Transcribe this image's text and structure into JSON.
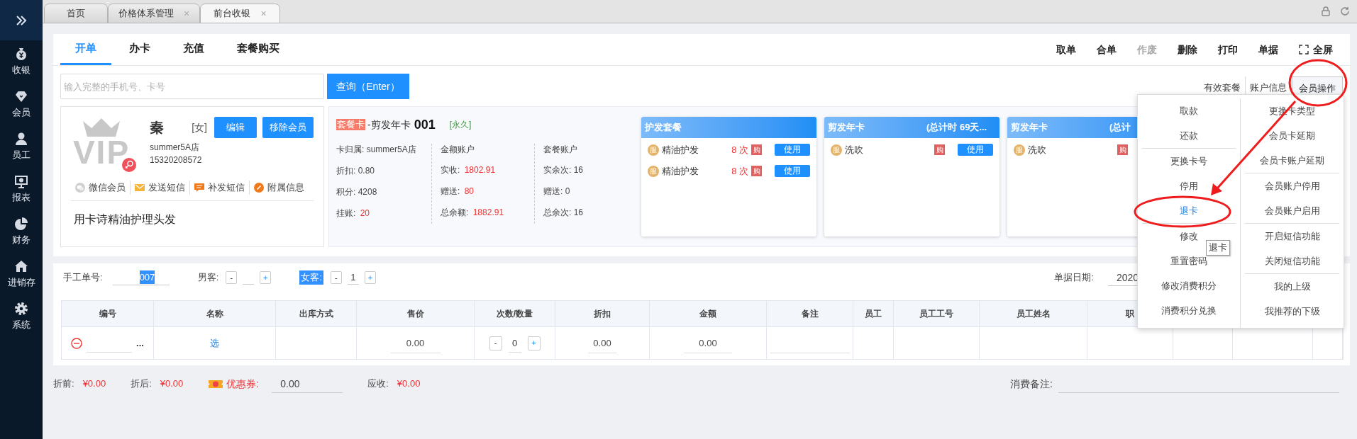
{
  "top_tabs": [
    {
      "label": "首页",
      "selected": false
    },
    {
      "label": "价格体系管理",
      "close": "×",
      "selected": false
    },
    {
      "label": "前台收银",
      "close": "×",
      "selected": true
    }
  ],
  "sidebar": {
    "items": [
      {
        "label": "收银",
        "kind": "cashier"
      },
      {
        "label": "会员",
        "kind": "member"
      },
      {
        "label": "员工",
        "kind": "staff"
      },
      {
        "label": "报表",
        "kind": "report"
      },
      {
        "label": "财务",
        "kind": "finance"
      },
      {
        "label": "进销存",
        "kind": "inventory"
      },
      {
        "label": "系统",
        "kind": "system"
      }
    ]
  },
  "order_tabs": [
    {
      "label": "开单",
      "selected": true
    },
    {
      "label": "办卡",
      "selected": false
    },
    {
      "label": "充值",
      "selected": false
    },
    {
      "label": "套餐购买",
      "selected": false
    }
  ],
  "toolbar": [
    {
      "label": "取单",
      "kind": "plain",
      "disabled": false
    },
    {
      "label": "合单",
      "kind": "plain",
      "disabled": false
    },
    {
      "label": "作废",
      "kind": "plain",
      "disabled": true
    },
    {
      "label": "删除",
      "kind": "plain",
      "disabled": false
    },
    {
      "label": "打印",
      "kind": "plain",
      "disabled": false
    },
    {
      "label": "单据",
      "kind": "plain",
      "disabled": false
    },
    {
      "label": "全屏",
      "kind": "fullscreen",
      "disabled": false
    }
  ],
  "search": {
    "placeholder": "输入完整的手机号、卡号",
    "button": "查询（Enter）"
  },
  "member_tabs": [
    {
      "label": "有效套餐",
      "selected": false
    },
    {
      "label": "账户信息",
      "selected": false
    },
    {
      "label": "会员操作",
      "selected": true
    }
  ],
  "member": {
    "avatar_text": "VIP",
    "name": "秦",
    "gender": "[女]",
    "buttons": [
      "编辑",
      "移除会员"
    ],
    "store": "summer5A店",
    "phone": "15320208572",
    "actions": [
      {
        "label": "微信会员",
        "kind": "wechat"
      },
      {
        "label": "发送短信",
        "kind": "mail"
      },
      {
        "label": "补发短信",
        "kind": "message"
      },
      {
        "label": "附属信息",
        "kind": "link"
      }
    ],
    "note": "用卡诗精油护理头发"
  },
  "card": {
    "type_tag": "套餐卡",
    "name": "-剪发年卡",
    "number": "001",
    "validity": "[永久]",
    "columns": [
      {
        "rows": [
          {
            "label": "卡归属:",
            "value": "summer5A店",
            "highlight": false
          },
          {
            "label": "折扣:",
            "value": "0.80",
            "highlight": false
          },
          {
            "label": "积分:",
            "value": "4208",
            "highlight": false
          },
          {
            "label": "挂账:",
            "value": "20",
            "highlight": true
          }
        ]
      },
      {
        "heading": "金额账户",
        "rows": [
          {
            "label": "实收:",
            "value": "1802.91",
            "highlight": true
          },
          {
            "label": "赠送:",
            "value": "80",
            "highlight": true
          },
          {
            "label": "总余额:",
            "value": "1882.91",
            "highlight": true
          }
        ]
      },
      {
        "heading": "套餐账户",
        "rows": [
          {
            "label": "实余次:",
            "value": "16",
            "highlight": false
          },
          {
            "label": "赠送:",
            "value": "0",
            "highlight": false
          },
          {
            "label": "总余次:",
            "value": "16",
            "highlight": false
          }
        ]
      }
    ]
  },
  "packages": [
    {
      "title": "护发套餐",
      "items": [
        {
          "badge": "服",
          "name": "精油护发",
          "count": "8 次",
          "buy": "购",
          "use": "使用"
        },
        {
          "badge": "服",
          "name": "精油护发",
          "count": "8 次",
          "buy": "购",
          "use": "使用"
        }
      ]
    },
    {
      "title": "剪发年卡",
      "subtitle": "(总计时 69天...",
      "items": [
        {
          "badge": "服",
          "name": "洗吹",
          "buy": "购",
          "use": "使用"
        }
      ]
    },
    {
      "title": "剪发年卡",
      "subtitle": "(总计",
      "items": [
        {
          "badge": "服",
          "name": "洗吹",
          "buy": "购"
        }
      ]
    }
  ],
  "member_menu": {
    "columns": [
      {
        "groups": [
          {
            "items": [
              {
                "label": "取款",
                "selected": false
              },
              {
                "label": "还款",
                "selected": false
              }
            ]
          },
          {
            "items": [
              {
                "label": "更换卡号",
                "selected": false
              },
              {
                "label": "停用",
                "selected": false
              },
              {
                "label": "退卡",
                "selected": true
              }
            ]
          },
          {
            "items": [
              {
                "label": "修改",
                "selected": false
              },
              {
                "label": "重置密码",
                "selected": false
              },
              {
                "label": "修改消费积分",
                "selected": false
              },
              {
                "label": "消费积分兑换",
                "selected": false
              }
            ]
          }
        ]
      },
      {
        "groups": [
          {
            "items": [
              {
                "label": "更换卡类型",
                "selected": false
              },
              {
                "label": "会员卡延期",
                "selected": false
              },
              {
                "label": "会员卡账户延期",
                "selected": false
              }
            ]
          },
          {
            "items": [
              {
                "label": "会员账户停用",
                "selected": false
              },
              {
                "label": "会员账户启用",
                "selected": false
              }
            ]
          },
          {
            "items": [
              {
                "label": "开启短信功能",
                "selected": false
              },
              {
                "label": "关闭短信功能",
                "selected": false
              }
            ]
          },
          {
            "items": [
              {
                "label": "我的上级",
                "selected": false
              },
              {
                "label": "我推荐的下级",
                "selected": false
              }
            ]
          }
        ]
      }
    ],
    "tooltip": "退卡"
  },
  "form": {
    "manual_no": {
      "label": "手工单号:",
      "value": "007",
      "selected": true
    },
    "male": {
      "label": "男客:",
      "minus": "-",
      "plus": "+",
      "selected": false
    },
    "female": {
      "label": "女客:",
      "minus": "-",
      "value": "1",
      "plus": "+",
      "selected": true
    },
    "date": {
      "label": "单据日期:",
      "value": "2020"
    }
  },
  "table": {
    "columns": [
      "编号",
      "名称",
      "出库方式",
      "售价",
      "次数/数量",
      "折扣",
      "金额",
      "备注",
      "员工",
      "员工工号",
      "员工姓名",
      "职"
    ],
    "rows": [
      {
        "more": "...",
        "pick": "选",
        "price": "0.00",
        "qty_minus": "-",
        "qty": "0",
        "qty_plus": "+",
        "discount": "0.00",
        "amount": "0.00"
      }
    ]
  },
  "summary": [
    {
      "label": "折前:",
      "value": "¥0.00",
      "kind": "amount"
    },
    {
      "label": "折后:",
      "value": "¥0.00",
      "kind": "amount"
    },
    {
      "label": "优惠券:",
      "value": "0.00",
      "kind": "coupon"
    },
    {
      "label": "应收:",
      "value": "¥0.00",
      "kind": "amount"
    }
  ],
  "remark": {
    "label": "消费备注:"
  }
}
